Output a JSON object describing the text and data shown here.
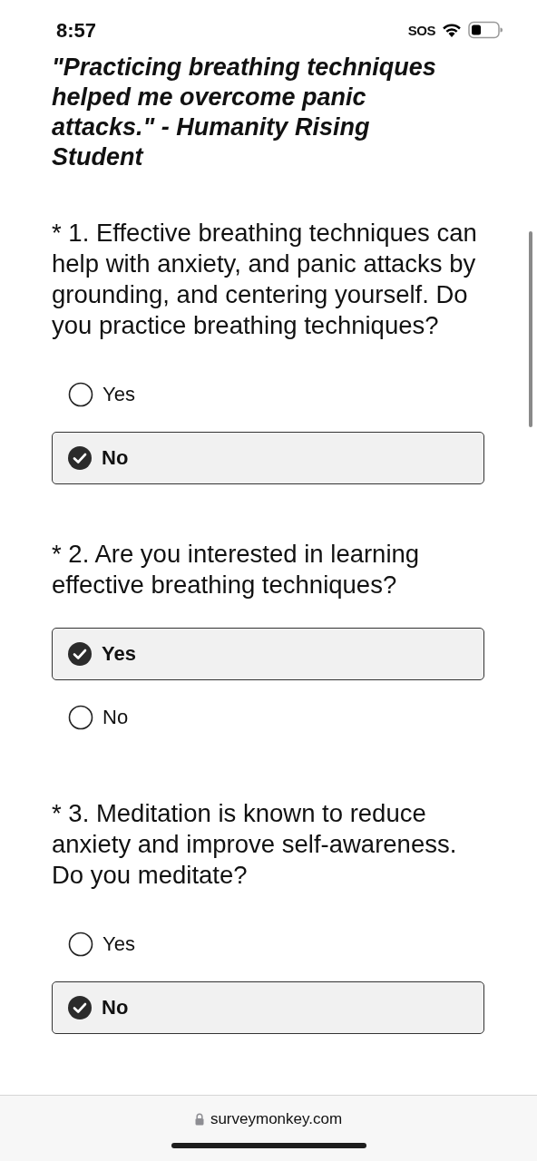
{
  "status_bar": {
    "time": "8:57",
    "carrier": "SOS"
  },
  "quote": "\"Practicing breathing techniques helped me overcome panic attacks.\" - Humanity Rising Student",
  "questions": [
    {
      "text": "* 1. Effective breathing techniques can help with anxiety, and panic attacks by grounding, and centering yourself. Do you practice breathing techniques?",
      "options": [
        {
          "label": "Yes",
          "selected": false
        },
        {
          "label": "No",
          "selected": true
        }
      ]
    },
    {
      "text": "* 2. Are you interested in learning effective breathing techniques?",
      "options": [
        {
          "label": "Yes",
          "selected": true
        },
        {
          "label": "No",
          "selected": false
        }
      ]
    },
    {
      "text": "* 3. Meditation is known to reduce anxiety and improve self-awareness. Do you meditate?",
      "options": [
        {
          "label": "Yes",
          "selected": false
        },
        {
          "label": "No",
          "selected": true
        }
      ]
    }
  ],
  "address_bar": {
    "url": "surveymonkey.com"
  }
}
